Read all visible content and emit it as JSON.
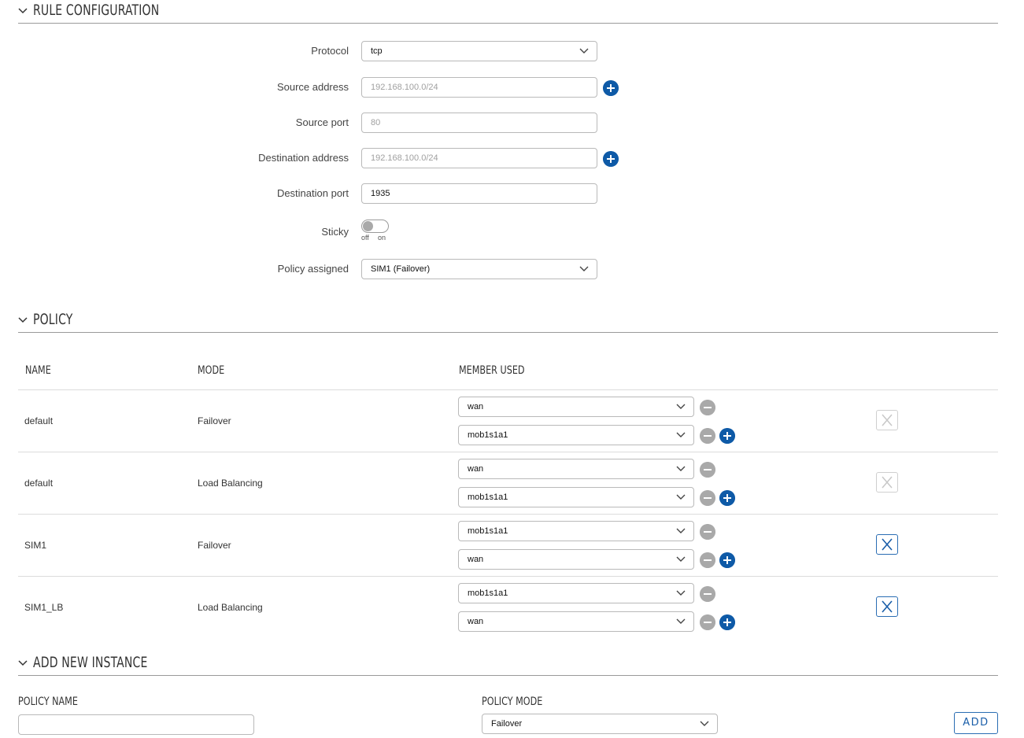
{
  "rule_config": {
    "title": "RULE CONFIGURATION",
    "protocol_label": "Protocol",
    "protocol_value": "tcp",
    "src_addr_label": "Source address",
    "src_addr_placeholder": "192.168.100.0/24",
    "src_port_label": "Source port",
    "src_port_placeholder": "80",
    "dst_addr_label": "Destination address",
    "dst_addr_placeholder": "192.168.100.0/24",
    "dst_port_label": "Destination port",
    "dst_port_value": "1935",
    "sticky_label": "Sticky",
    "sticky_off": "off",
    "sticky_on": "on",
    "policy_label": "Policy assigned",
    "policy_value": "SIM1 (Failover)"
  },
  "policy": {
    "title": "POLICY",
    "headers": {
      "name": "NAME",
      "mode": "MODE",
      "member": "MEMBER USED"
    },
    "rows": [
      {
        "name": "default",
        "mode": "Failover",
        "members": [
          "wan",
          "mob1s1a1"
        ],
        "deletable": false
      },
      {
        "name": "default",
        "mode": "Load Balancing",
        "members": [
          "wan",
          "mob1s1a1"
        ],
        "deletable": false
      },
      {
        "name": "SIM1",
        "mode": "Failover",
        "members": [
          "mob1s1a1",
          "wan"
        ],
        "deletable": true
      },
      {
        "name": "SIM1_LB",
        "mode": "Load Balancing",
        "members": [
          "mob1s1a1",
          "wan"
        ],
        "deletable": true
      }
    ]
  },
  "add_instance": {
    "title": "ADD NEW INSTANCE",
    "name_label": "POLICY NAME",
    "name_value": "",
    "mode_label": "POLICY MODE",
    "mode_value": "Failover",
    "add_label": "ADD"
  },
  "colors": {
    "accent": "#0e5aa7",
    "border": "#b9b9b9",
    "disabled": "#a9a9a9"
  }
}
